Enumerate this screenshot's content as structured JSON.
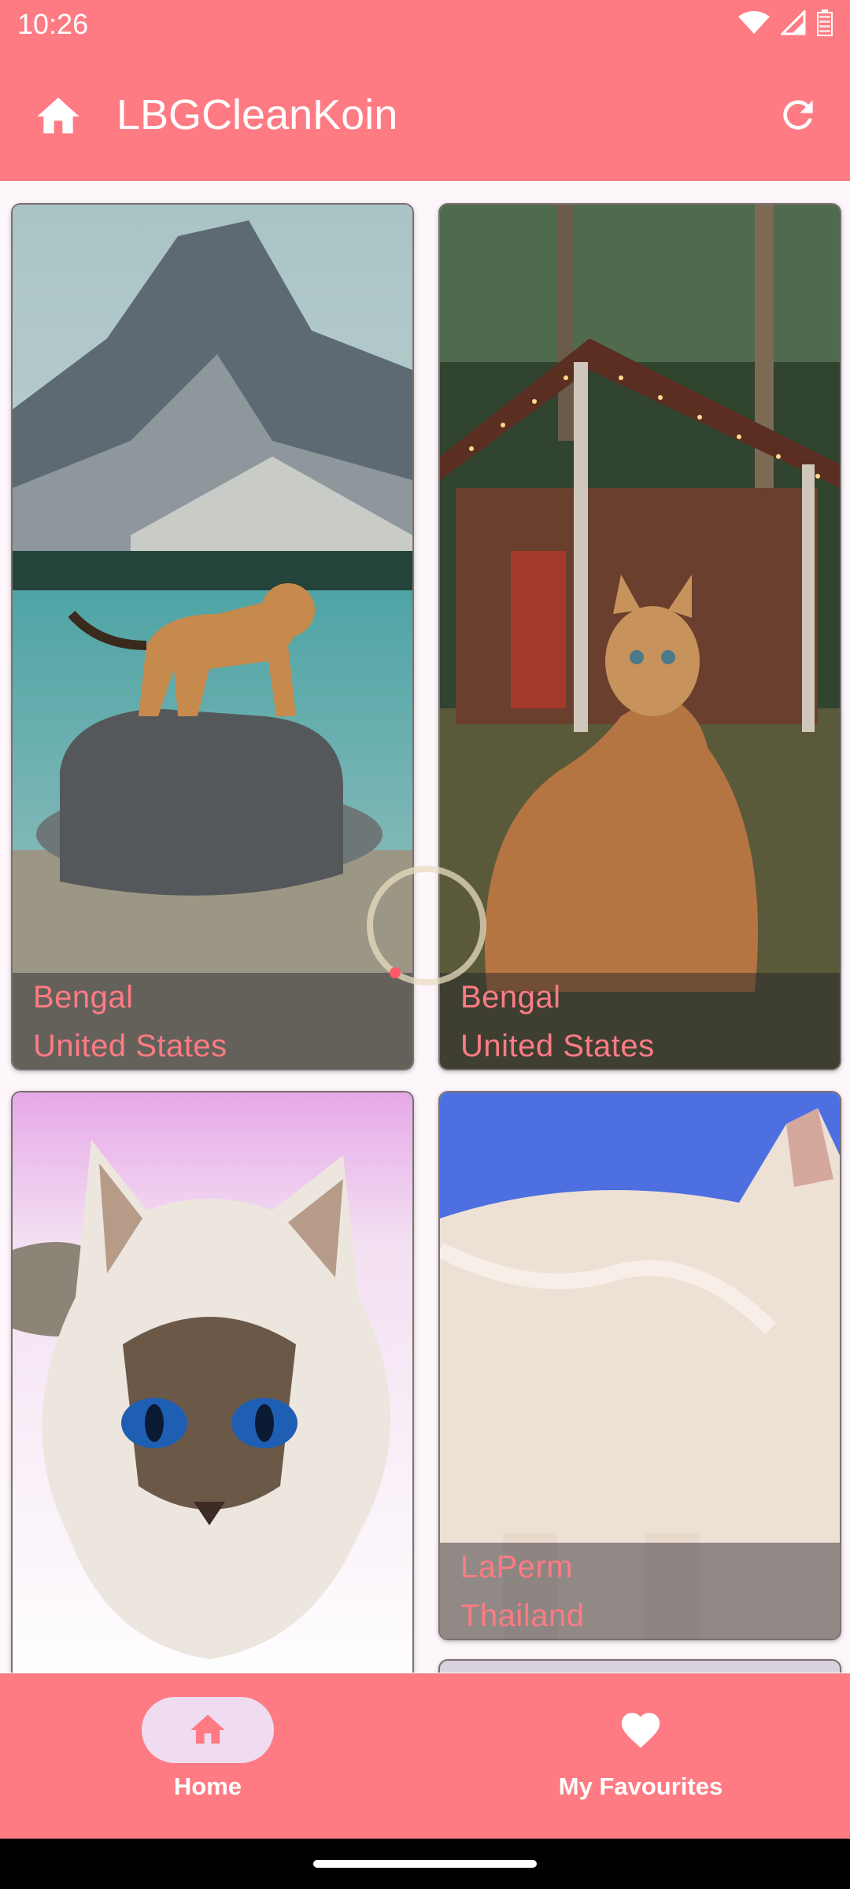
{
  "status_bar": {
    "time": "10:26"
  },
  "app_bar": {
    "title": "LBGCleanKoin"
  },
  "cards": [
    {
      "breed": "Bengal",
      "origin": "United States"
    },
    {
      "breed": "Bengal",
      "origin": "United States"
    },
    {
      "breed": "",
      "origin": ""
    },
    {
      "breed": "LaPerm",
      "origin": "Thailand"
    }
  ],
  "bottom_nav": {
    "items": [
      {
        "label": "Home",
        "icon": "home-icon",
        "selected": true
      },
      {
        "label": "My Favourites",
        "icon": "heart-icon",
        "selected": false
      }
    ]
  },
  "colors": {
    "primary": "#fe7b83",
    "caption_text": "#ff7b84",
    "nav_indicator": "#efdcf0"
  }
}
